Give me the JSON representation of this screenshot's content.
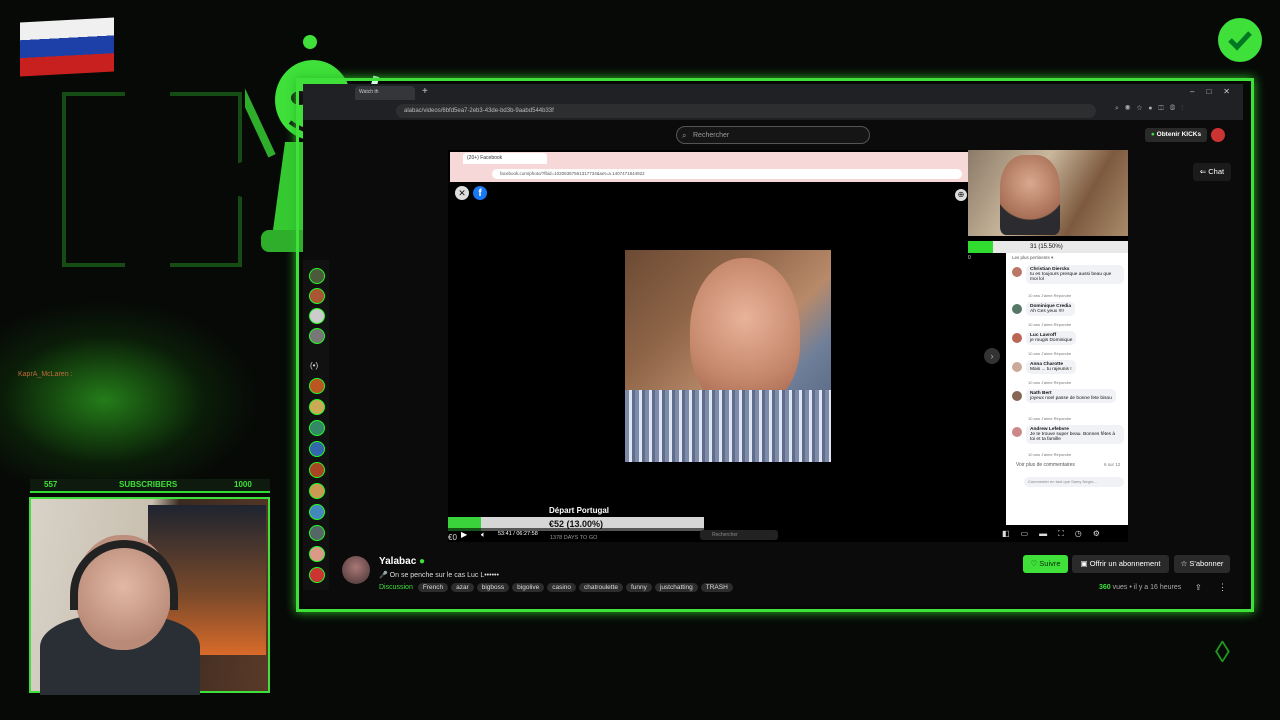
{
  "overlay": {
    "chat_user": "KaprA_McLaren :",
    "subs_current": "557",
    "subs_label": "SUBSCRIBERS",
    "subs_goal": "1000"
  },
  "browser": {
    "tab_title": "Watch th",
    "address": "alabac/videos/6bfd5ea7-2eb3-43de-bd3b-9aabd544b33f"
  },
  "kick": {
    "search_placeholder": "Rechercher",
    "get_kicks": "Obtenir KICKs",
    "chat_button": "Chat"
  },
  "fb": {
    "tab_title": "(20+) Facebook",
    "address": "facebook.com/photo/?fbid=10206367561317734&set=a.1407471844922"
  },
  "stream_overlay": {
    "top_progress": "31 (15.50%)",
    "top_progress_left": "0",
    "goal_title": "Départ Portugal",
    "goal_value": "€52 (13.00%)",
    "goal_days": "1378 DAYS TO GO",
    "goal_start": "€0",
    "progress_fraction": 0.13
  },
  "comments": {
    "sort_label": "Les plus pertinents",
    "items": [
      {
        "name": "Christian Dierckx",
        "text": "tu es toujours presque aussi beau que moi lol",
        "meta": "10 ans   J'aime   Répondre"
      },
      {
        "name": "Dominique Credia",
        "text": "Ah Ces yeux !!!!",
        "meta": "10 ans   J'aime   Répondre"
      },
      {
        "name": "Luc Lavroff",
        "text": "je rougis Dominique",
        "meta": "10 ans   J'aime   Répondre"
      },
      {
        "name": "Anna Charotte",
        "text": "Mais ... tu rajeunis !",
        "meta": "10 ans   J'aime   Répondre"
      },
      {
        "name": "Nath Bert",
        "text": "joyeux noel passe de bonne fete bisou",
        "meta": "10 ans   J'aime   Répondre"
      },
      {
        "name": "Andrew Lefebvre",
        "text": "Je te trouve super beau. Bonnes fêtes à toi et ta famille",
        "meta": "10 ans   J'aime   Répondre"
      }
    ],
    "more": "Voir plus de commentaires",
    "more_count": "6 sur 12",
    "input_placeholder": "Commenter en tant que Samy Negro..."
  },
  "player": {
    "time": "53:41 / 06:27:58",
    "search_placeholder": "Rechercher"
  },
  "channel": {
    "name": "Yalabac",
    "title": "🎤 On se penche sur le cas Luc L••••••",
    "category": "Discussion",
    "tags": [
      "French",
      "azar",
      "bigboss",
      "bigolive",
      "casino",
      "chatroulette",
      "funny",
      "justchatting",
      "TRASH"
    ],
    "follow": "Suivre",
    "gift_sub": "Offrir un abonnement",
    "subscribe": "S'abonner",
    "views_count": "360",
    "views_label": "vues",
    "ago": "il y a 16 heures"
  },
  "colors": {
    "accent": "#3fe03a",
    "bg": "#070907"
  }
}
